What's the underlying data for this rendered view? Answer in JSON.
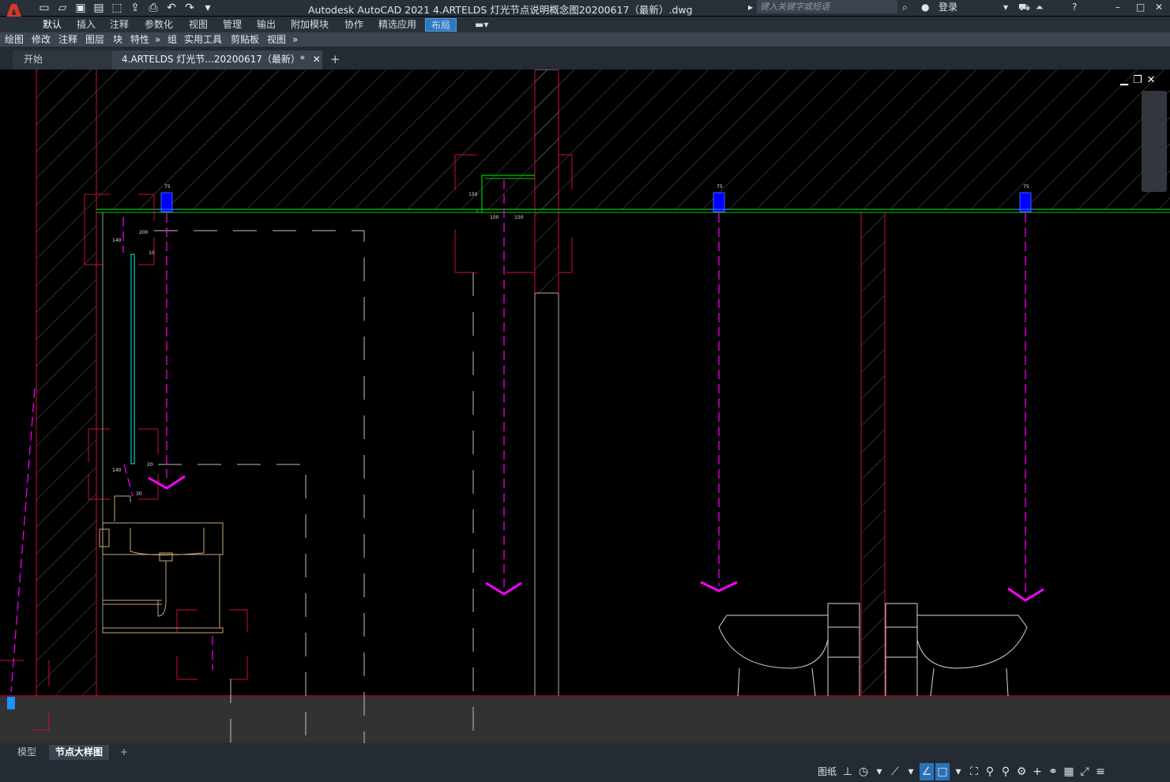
{
  "app": {
    "logo_letter": "A",
    "title": "Autodesk AutoCAD 2021    4.ARTELDS 灯光节点说明概念图20200617（最新）.dwg",
    "search_placeholder": "键入关键字或短语",
    "login": "登录"
  },
  "quick_access": [
    "new-icon",
    "open-icon",
    "save-icon",
    "save-as-icon",
    "export-icon",
    "share-icon",
    "plot-icon",
    "undo-icon",
    "redo-icon",
    "customize-icon"
  ],
  "ribbon_tabs": [
    "默认",
    "插入",
    "注释",
    "参数化",
    "视图",
    "管理",
    "输出",
    "附加模块",
    "协作",
    "精选应用",
    "布局"
  ],
  "ribbon_active": "默认",
  "ribbon_boxed": "布局",
  "panels": [
    "绘图",
    "修改",
    "注释",
    "图层",
    "块",
    "特性",
    "组",
    "实用工具",
    "剪贴板",
    "视图"
  ],
  "file_tabs": {
    "start": "开始",
    "doc": "4.ARTELDS 灯光节...20200617（最新）*",
    "close": "✕",
    "add": "+"
  },
  "dimensions": {
    "d75": "75",
    "d140": "140",
    "d200": "200",
    "d10": "10",
    "d150": "150",
    "d100": "100",
    "d20": "20",
    "d30": "30"
  },
  "layout_tabs": {
    "model": "模型",
    "active": "节点大样图",
    "add": "+"
  },
  "status": {
    "paper": "图纸",
    "icons": [
      "grid-icon",
      "snap-icon",
      "ortho-icon",
      "polar-icon",
      "osnap-icon",
      "otrack-icon",
      "annotation-icon",
      "scale-icon",
      "workspace-icon",
      "gear-icon",
      "plus-icon",
      "isolate-icon",
      "hardware-icon",
      "fullscreen-icon",
      "menu-icon"
    ]
  },
  "colors": {
    "cad_bg": "#000000",
    "ui_dark": "#242b33",
    "accent": "#2b79c5",
    "wall": "#c8102e",
    "ceiling": "#00c800",
    "light": "#ff00ff",
    "fixture": "#0000ff"
  }
}
